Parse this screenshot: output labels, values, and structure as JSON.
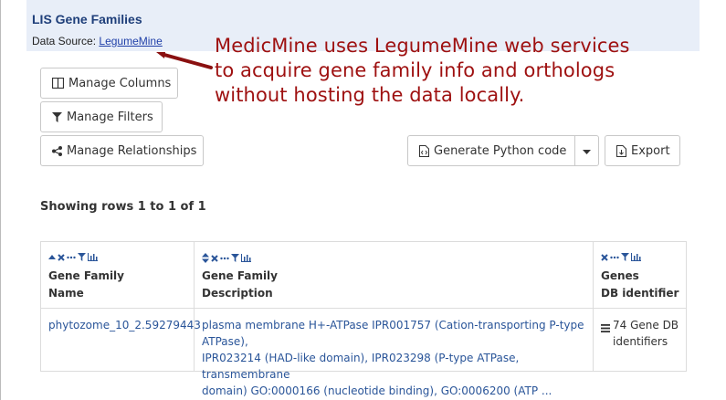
{
  "header": {
    "title": "LIS Gene Families",
    "source_label": "Data Source:",
    "source_link": "LegumeMine"
  },
  "annotation": {
    "line1": "MedicMine uses LegumeMine web services",
    "line2": "to acquire gene family info and orthologs",
    "line3": "without hosting the data locally."
  },
  "toolbar": {
    "manage_columns": "Manage Columns",
    "manage_filters": "Manage Filters",
    "manage_relationships": "Manage Relationships",
    "generate_code": "Generate Python code",
    "export": "Export"
  },
  "status": {
    "showing": "Showing rows 1 to 1 of 1"
  },
  "table": {
    "columns": [
      {
        "line1": "Gene Family",
        "line2": "Name"
      },
      {
        "line1": "Gene Family",
        "line2": "Description"
      },
      {
        "line1": "Genes",
        "line2": "DB identifier"
      }
    ],
    "rows": [
      {
        "name": "phytozome_10_2.59279443",
        "description_lines": [
          "plasma membrane H+-ATPase IPR001757 (Cation-transporting P-type ATPase),",
          "IPR023214 (HAD-like domain), IPR023298 (P-type ATPase, transmembrane",
          "domain) GO:0000166 (nucleotide binding), GO:0006200 (ATP ..."
        ],
        "genes_line1": "74 Gene DB",
        "genes_line2": "identifiers"
      }
    ]
  },
  "colors": {
    "annotation": "#9e1010",
    "header_bg": "#e8eef8",
    "title": "#1f3f7a",
    "link": "#2a5599",
    "tools": "#2a5599"
  }
}
